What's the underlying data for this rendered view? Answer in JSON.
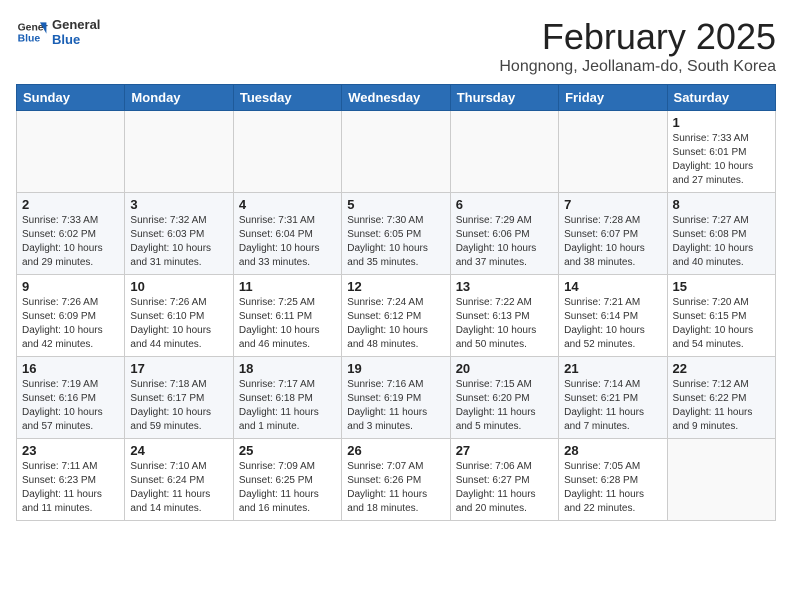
{
  "header": {
    "logo_general": "General",
    "logo_blue": "Blue",
    "title": "February 2025",
    "subtitle": "Hongnong, Jeollanam-do, South Korea"
  },
  "weekdays": [
    "Sunday",
    "Monday",
    "Tuesday",
    "Wednesday",
    "Thursday",
    "Friday",
    "Saturday"
  ],
  "weeks": [
    [
      {
        "day": "",
        "info": ""
      },
      {
        "day": "",
        "info": ""
      },
      {
        "day": "",
        "info": ""
      },
      {
        "day": "",
        "info": ""
      },
      {
        "day": "",
        "info": ""
      },
      {
        "day": "",
        "info": ""
      },
      {
        "day": "1",
        "info": "Sunrise: 7:33 AM\nSunset: 6:01 PM\nDaylight: 10 hours\nand 27 minutes."
      }
    ],
    [
      {
        "day": "2",
        "info": "Sunrise: 7:33 AM\nSunset: 6:02 PM\nDaylight: 10 hours\nand 29 minutes."
      },
      {
        "day": "3",
        "info": "Sunrise: 7:32 AM\nSunset: 6:03 PM\nDaylight: 10 hours\nand 31 minutes."
      },
      {
        "day": "4",
        "info": "Sunrise: 7:31 AM\nSunset: 6:04 PM\nDaylight: 10 hours\nand 33 minutes."
      },
      {
        "day": "5",
        "info": "Sunrise: 7:30 AM\nSunset: 6:05 PM\nDaylight: 10 hours\nand 35 minutes."
      },
      {
        "day": "6",
        "info": "Sunrise: 7:29 AM\nSunset: 6:06 PM\nDaylight: 10 hours\nand 37 minutes."
      },
      {
        "day": "7",
        "info": "Sunrise: 7:28 AM\nSunset: 6:07 PM\nDaylight: 10 hours\nand 38 minutes."
      },
      {
        "day": "8",
        "info": "Sunrise: 7:27 AM\nSunset: 6:08 PM\nDaylight: 10 hours\nand 40 minutes."
      }
    ],
    [
      {
        "day": "9",
        "info": "Sunrise: 7:26 AM\nSunset: 6:09 PM\nDaylight: 10 hours\nand 42 minutes."
      },
      {
        "day": "10",
        "info": "Sunrise: 7:26 AM\nSunset: 6:10 PM\nDaylight: 10 hours\nand 44 minutes."
      },
      {
        "day": "11",
        "info": "Sunrise: 7:25 AM\nSunset: 6:11 PM\nDaylight: 10 hours\nand 46 minutes."
      },
      {
        "day": "12",
        "info": "Sunrise: 7:24 AM\nSunset: 6:12 PM\nDaylight: 10 hours\nand 48 minutes."
      },
      {
        "day": "13",
        "info": "Sunrise: 7:22 AM\nSunset: 6:13 PM\nDaylight: 10 hours\nand 50 minutes."
      },
      {
        "day": "14",
        "info": "Sunrise: 7:21 AM\nSunset: 6:14 PM\nDaylight: 10 hours\nand 52 minutes."
      },
      {
        "day": "15",
        "info": "Sunrise: 7:20 AM\nSunset: 6:15 PM\nDaylight: 10 hours\nand 54 minutes."
      }
    ],
    [
      {
        "day": "16",
        "info": "Sunrise: 7:19 AM\nSunset: 6:16 PM\nDaylight: 10 hours\nand 57 minutes."
      },
      {
        "day": "17",
        "info": "Sunrise: 7:18 AM\nSunset: 6:17 PM\nDaylight: 10 hours\nand 59 minutes."
      },
      {
        "day": "18",
        "info": "Sunrise: 7:17 AM\nSunset: 6:18 PM\nDaylight: 11 hours\nand 1 minute."
      },
      {
        "day": "19",
        "info": "Sunrise: 7:16 AM\nSunset: 6:19 PM\nDaylight: 11 hours\nand 3 minutes."
      },
      {
        "day": "20",
        "info": "Sunrise: 7:15 AM\nSunset: 6:20 PM\nDaylight: 11 hours\nand 5 minutes."
      },
      {
        "day": "21",
        "info": "Sunrise: 7:14 AM\nSunset: 6:21 PM\nDaylight: 11 hours\nand 7 minutes."
      },
      {
        "day": "22",
        "info": "Sunrise: 7:12 AM\nSunset: 6:22 PM\nDaylight: 11 hours\nand 9 minutes."
      }
    ],
    [
      {
        "day": "23",
        "info": "Sunrise: 7:11 AM\nSunset: 6:23 PM\nDaylight: 11 hours\nand 11 minutes."
      },
      {
        "day": "24",
        "info": "Sunrise: 7:10 AM\nSunset: 6:24 PM\nDaylight: 11 hours\nand 14 minutes."
      },
      {
        "day": "25",
        "info": "Sunrise: 7:09 AM\nSunset: 6:25 PM\nDaylight: 11 hours\nand 16 minutes."
      },
      {
        "day": "26",
        "info": "Sunrise: 7:07 AM\nSunset: 6:26 PM\nDaylight: 11 hours\nand 18 minutes."
      },
      {
        "day": "27",
        "info": "Sunrise: 7:06 AM\nSunset: 6:27 PM\nDaylight: 11 hours\nand 20 minutes."
      },
      {
        "day": "28",
        "info": "Sunrise: 7:05 AM\nSunset: 6:28 PM\nDaylight: 11 hours\nand 22 minutes."
      },
      {
        "day": "",
        "info": ""
      }
    ]
  ]
}
